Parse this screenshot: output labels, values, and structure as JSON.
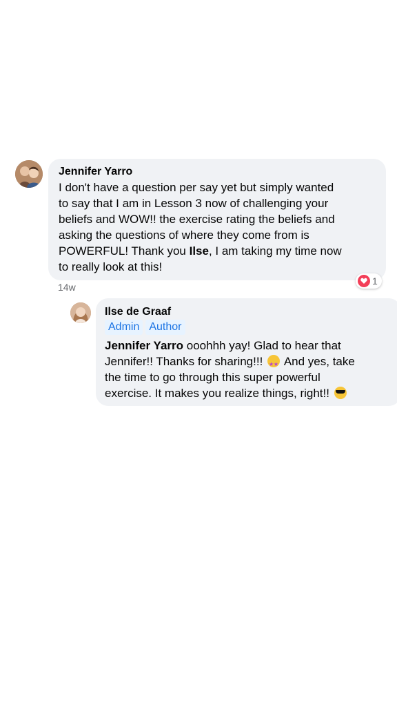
{
  "comment": {
    "author": "Jennifer Yarro",
    "line1": "I don't have a question per say yet but simply wanted",
    "line2": "to say that I am in Lesson 3 now of challenging your",
    "line3": "beliefs and WOW!! the exercise rating the beliefs and",
    "line4": "asking the questions of where they come from is",
    "line5_a": "POWERFUL! Thank you ",
    "line5_mention": "Ilse",
    "line5_b": ", I am taking my time now",
    "line6": "to really look at this!",
    "time": "14w",
    "reaction_count": "1",
    "reaction_icon": "love-icon",
    "reaction_color": "#f33e58"
  },
  "reply": {
    "author": "Ilse de Graaf",
    "badges": [
      "Admin",
      "Author"
    ],
    "mention": "Jennifer Yarro",
    "line1_rest": " ooohhh yay! Glad to hear that",
    "line2": "Jennifer!! Thanks for sharing!!! ",
    "line2_emoji": "star-struck-emoji",
    "line2_rest": " And yes, take",
    "line3": "the time to go through this super powerful",
    "line4": "exercise. It makes you realize things, right!! ",
    "line4_emoji": "sunglasses-emoji"
  },
  "colors": {
    "bubble": "#f0f2f5",
    "badge_bg": "#e7f3ff",
    "badge_text": "#1b74e4",
    "meta_text": "#65676b"
  }
}
